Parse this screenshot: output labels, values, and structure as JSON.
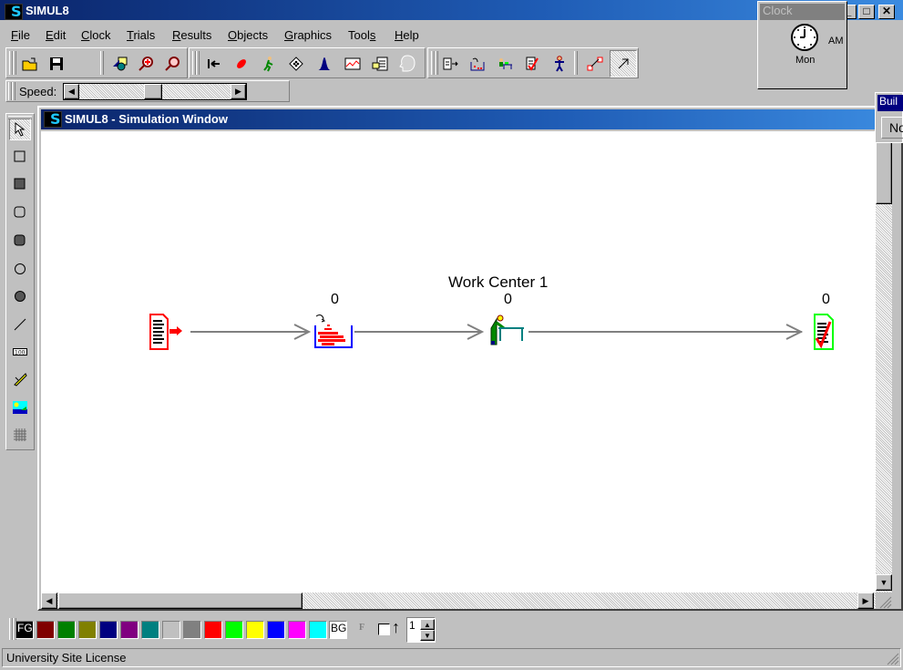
{
  "app": {
    "title": "SIMUL8",
    "logo": "S"
  },
  "window_controls": {
    "minimize": "_",
    "maximize": "□",
    "close": "✕"
  },
  "menu": [
    {
      "label": "File",
      "accel": "F"
    },
    {
      "label": "Edit",
      "accel": "E"
    },
    {
      "label": "Clock",
      "accel": "C"
    },
    {
      "label": "Trials",
      "accel": "T"
    },
    {
      "label": "Results",
      "accel": "R"
    },
    {
      "label": "Objects",
      "accel": "O"
    },
    {
      "label": "Graphics",
      "accel": "G"
    },
    {
      "label": "Tools",
      "accel": "s"
    },
    {
      "label": "Help",
      "accel": "H"
    }
  ],
  "toolbar": {
    "file": [
      "open-folder",
      "save"
    ],
    "view": [
      "shapes",
      "zoom-in",
      "zoom-out"
    ],
    "run": [
      "reset",
      "step",
      "run",
      "dice",
      "distribution",
      "graph",
      "report",
      "visual-logic"
    ],
    "objects": [
      "work-entry-point",
      "storage-bin",
      "work-center",
      "work-exit-point",
      "resource"
    ],
    "routes": [
      "route-link",
      "arrow-pointer"
    ]
  },
  "speed": {
    "label": "Speed:",
    "value_fraction": 0.5
  },
  "clock": {
    "title": "Clock",
    "ampm": "AM",
    "day": "Mon"
  },
  "build_panel": {
    "title": "Buil",
    "button": "No"
  },
  "sim_window": {
    "title": "SIMUL8 - Simulation Window"
  },
  "left_tools": [
    "pointer",
    "rectangle",
    "filled-rectangle",
    "rounded-rectangle",
    "filled-rounded-rectangle",
    "ellipse",
    "filled-ellipse",
    "line",
    "counter",
    "pencil",
    "image",
    "grid"
  ],
  "model": {
    "entry": {
      "name": "Work Entry Point",
      "count": ""
    },
    "storage": {
      "name": "Storage Area",
      "count": "0"
    },
    "work_center": {
      "name": "Work Center 1",
      "count": "0"
    },
    "exit": {
      "name": "Work Exit Point",
      "count": "0"
    }
  },
  "palette": {
    "fg_label": "FG",
    "bg_label": "BG",
    "colors": [
      "#800000",
      "#008000",
      "#808000",
      "#000080",
      "#800080",
      "#008080",
      "#c0c0c0",
      "#808080",
      "#ff0000",
      "#00ff00",
      "#ffff00",
      "#0000ff",
      "#ff00ff",
      "#00ffff"
    ],
    "font_label": "F",
    "line_width": "1"
  },
  "status": {
    "text": "University Site License"
  }
}
